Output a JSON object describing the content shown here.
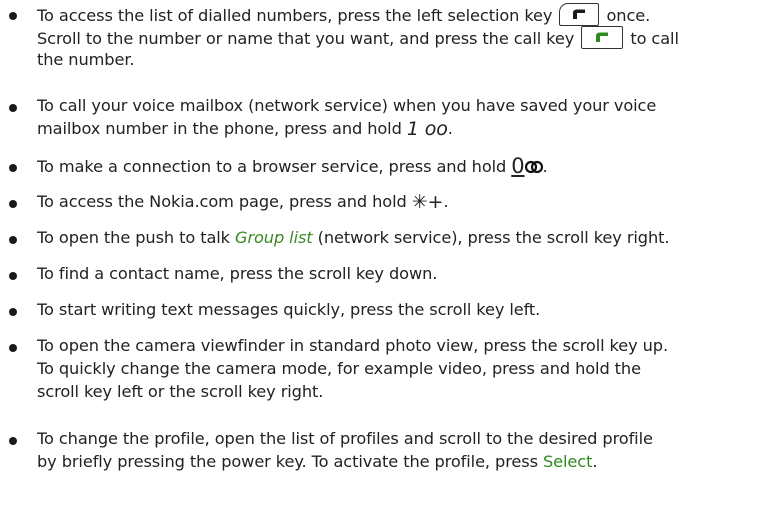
{
  "bullets": [
    {
      "line1_a": "To access the list of dialled numbers, press the left selection key",
      "line1_b": "once.",
      "line2_a": "Scroll to the number or name that you want, and press the call key",
      "line2_b": "to call",
      "line3": "the number."
    },
    {
      "line1": "To call your voice mailbox (network service) when you have saved your voice",
      "line2_a": "mailbox number in the phone, press and hold",
      "line2_key": "1 ᴏᴏ",
      "line2_b": "."
    },
    {
      "line1_a": "To make a connection to a browser service, press and hold",
      "line1_key": "0",
      "line1_b": "."
    },
    {
      "line1_a": "To access the Nokia.com page, press and hold",
      "line1_key": "✳+",
      "line1_b": "."
    },
    {
      "line1_a": "To open the push to talk",
      "line1_link": "Group list",
      "line1_b": "(network service), press the scroll key right."
    },
    {
      "line1": "To find a contact name, press the scroll key down."
    },
    {
      "line1": "To start writing text messages quickly, press the scroll key left."
    },
    {
      "line1": "To open the camera viewfinder in standard photo view, press the scroll key up.",
      "line2": "To quickly change the camera mode, for example video, press and hold the",
      "line3": "scroll key left or the scroll key right."
    },
    {
      "line1": "To change the profile, open the list of profiles and scroll to the desired profile",
      "line2_a": "by briefly pressing the power key. To activate the profile, press",
      "line2_link": "Select",
      "line2_b": "."
    }
  ]
}
